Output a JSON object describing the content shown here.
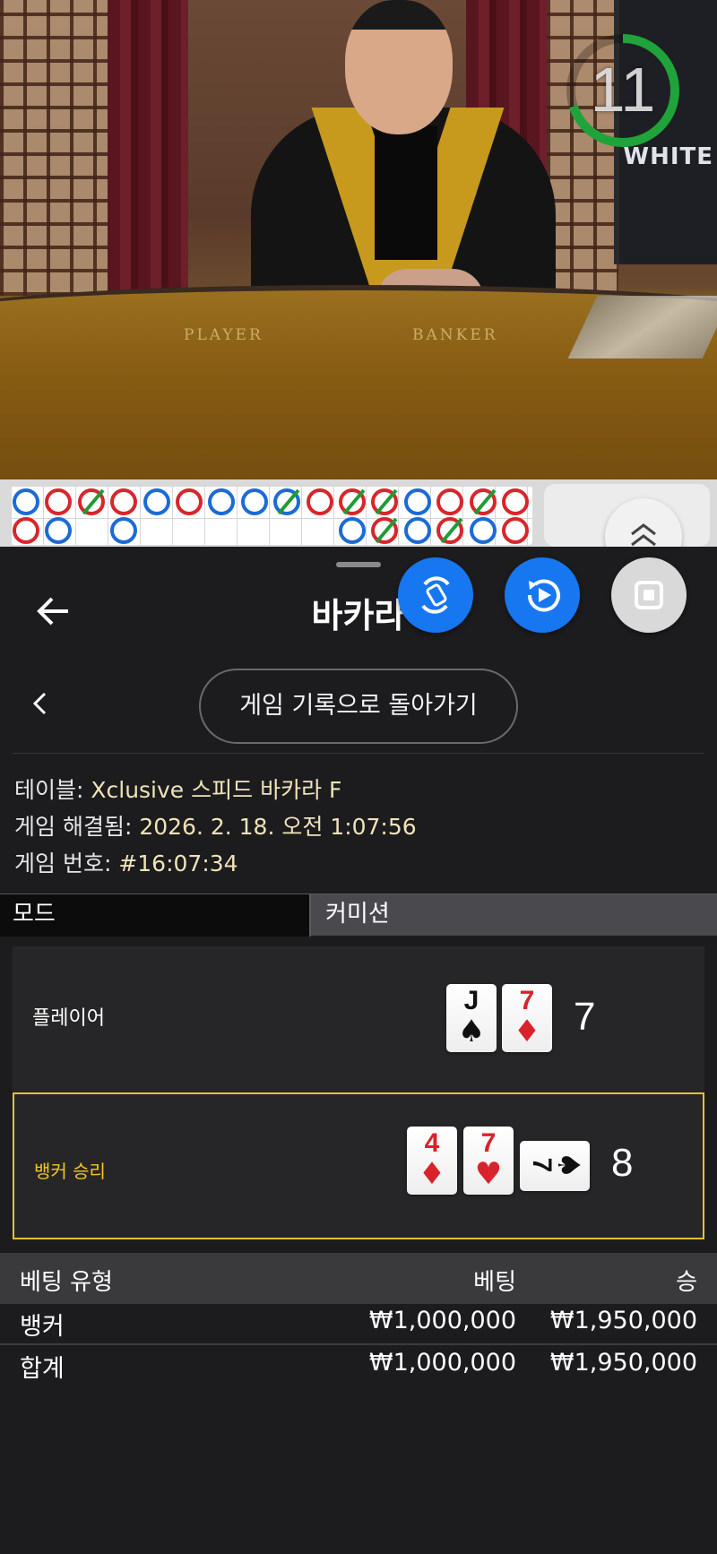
{
  "video": {
    "table_player_text": "PLAYER",
    "table_banker_text": "BANKER",
    "monitor_brand": "WHITE",
    "timer_value": "11",
    "timer_progress": 0.7
  },
  "road_map": {
    "beads": [
      {
        "c": "blue",
        "s": false
      },
      {
        "c": "red",
        "s": false
      },
      {
        "c": "red",
        "s": true
      },
      {
        "c": "red",
        "s": false
      },
      {
        "c": "blue",
        "s": false
      },
      {
        "c": "red",
        "s": false
      },
      {
        "c": "blue",
        "s": false
      },
      {
        "c": "blue",
        "s": false
      },
      {
        "c": "blue",
        "s": true
      },
      {
        "c": "red",
        "s": false
      },
      {
        "c": "red",
        "s": true
      },
      {
        "c": "red",
        "s": true
      },
      {
        "c": "blue",
        "s": false
      },
      {
        "c": "red",
        "s": false
      },
      {
        "c": "red",
        "s": true
      },
      {
        "c": "red",
        "s": false
      }
    ],
    "beads_row2": [
      {
        "c": "red",
        "s": false
      },
      {
        "c": "blue",
        "s": false
      },
      {
        "c": "none",
        "s": false
      },
      {
        "c": "blue",
        "s": false
      },
      {
        "c": "none",
        "s": false
      },
      {
        "c": "none",
        "s": false
      },
      {
        "c": "none",
        "s": false
      },
      {
        "c": "none",
        "s": false
      },
      {
        "c": "none",
        "s": false
      },
      {
        "c": "none",
        "s": false
      },
      {
        "c": "blue",
        "s": false
      },
      {
        "c": "red",
        "s": true
      },
      {
        "c": "blue",
        "s": false
      },
      {
        "c": "red",
        "s": true
      },
      {
        "c": "blue",
        "s": false
      },
      {
        "c": "red",
        "s": false
      }
    ]
  },
  "panel": {
    "title": "바카라",
    "history_button": "게임 기록으로 돌아가기",
    "info": {
      "table_label": "테이블: ",
      "table_value": "Xclusive 스피드 바카라 F",
      "resolved_label": "게임 해결됨: ",
      "resolved_value": "2026. 2. 18. 오전 1:07:56",
      "number_label": "게임 번호: ",
      "number_value": "#16:07:34"
    },
    "mode_label": "모드",
    "commission_label": "커미션",
    "player": {
      "label": "플레이어",
      "score": "7",
      "cards": [
        {
          "rank": "J",
          "suit": "♠",
          "color": "black"
        },
        {
          "rank": "7",
          "suit": "♦",
          "color": "red"
        }
      ]
    },
    "banker": {
      "label": "뱅커 승리",
      "score": "8",
      "cards": [
        {
          "rank": "4",
          "suit": "♦",
          "color": "red"
        },
        {
          "rank": "7",
          "suit": "♥",
          "color": "red"
        },
        {
          "rank": "7",
          "suit": "♠",
          "color": "black"
        }
      ]
    },
    "bets": {
      "header": {
        "type": "베팅 유형",
        "bet": "베팅",
        "win": "승"
      },
      "rows": [
        {
          "type": "뱅커",
          "bet": "₩1,000,000",
          "win": "₩1,950,000"
        }
      ],
      "total": {
        "type": "합계",
        "bet": "₩1,000,000",
        "win": "₩1,950,000"
      }
    }
  },
  "colors": {
    "accent_blue": "#1677f0",
    "win_gold": "#f4c52a",
    "info_value": "#f0e3b8",
    "timer_green": "#1fa33a"
  }
}
